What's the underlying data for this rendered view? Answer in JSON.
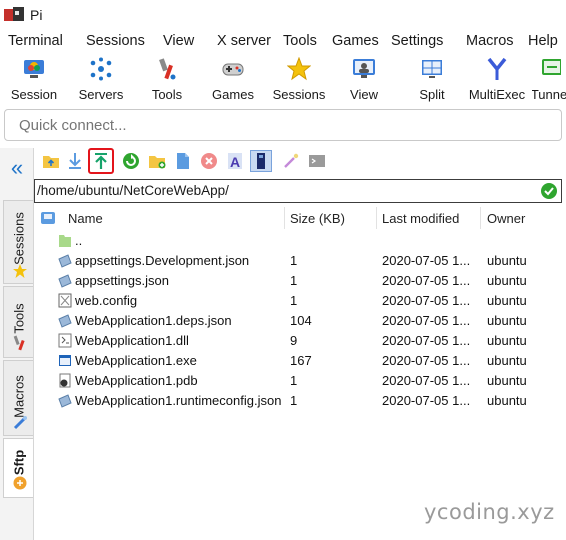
{
  "window": {
    "title": "Pi"
  },
  "menu": [
    "Terminal",
    "Sessions",
    "View",
    "X server",
    "Tools",
    "Games",
    "Settings",
    "Macros",
    "Help"
  ],
  "toolbar": [
    {
      "label": "Session",
      "icon": "session-icon"
    },
    {
      "label": "Servers",
      "icon": "servers-icon"
    },
    {
      "label": "Tools",
      "icon": "tools-icon"
    },
    {
      "label": "Games",
      "icon": "games-icon"
    },
    {
      "label": "Sessions",
      "icon": "star-icon"
    },
    {
      "label": "View",
      "icon": "view-icon"
    },
    {
      "label": "Split",
      "icon": "split-icon"
    },
    {
      "label": "MultiExec",
      "icon": "multiexec-icon"
    },
    {
      "label": "Tunne",
      "icon": "tunneling-icon"
    }
  ],
  "quick_connect": {
    "placeholder": "Quick connect..."
  },
  "sidebar": {
    "tabs": [
      {
        "label": "Sessions",
        "icon": "star-icon"
      },
      {
        "label": "Tools",
        "icon": "tools-icon"
      },
      {
        "label": "Macros",
        "icon": "macro-icon"
      },
      {
        "label": "Sftp",
        "icon": "sftp-icon"
      }
    ]
  },
  "sftp": {
    "toolbar_icons": [
      "parent-folder-icon",
      "download-icon",
      "upload-icon",
      "refresh-icon",
      "new-folder-icon",
      "new-file-icon",
      "delete-icon",
      "rename-icon",
      "follow-terminal-icon",
      "magic-wand-icon",
      "terminal-icon"
    ],
    "path": "/home/ubuntu/NetCoreWebApp/",
    "columns": [
      "Name",
      "Size (KB)",
      "Last modified",
      "Owner"
    ],
    "rows": [
      {
        "name": "..",
        "size": "",
        "modified": "",
        "owner": "",
        "icon": "parent-folder-icon"
      },
      {
        "name": "appsettings.Development.json",
        "size": "1",
        "modified": "2020-07-05 1...",
        "owner": "ubuntu",
        "icon": "json-file-icon"
      },
      {
        "name": "appsettings.json",
        "size": "1",
        "modified": "2020-07-05 1...",
        "owner": "ubuntu",
        "icon": "json-file-icon"
      },
      {
        "name": "web.config",
        "size": "1",
        "modified": "2020-07-05 1...",
        "owner": "ubuntu",
        "icon": "config-file-icon"
      },
      {
        "name": "WebApplication1.deps.json",
        "size": "104",
        "modified": "2020-07-05 1...",
        "owner": "ubuntu",
        "icon": "json-file-icon"
      },
      {
        "name": "WebApplication1.dll",
        "size": "9",
        "modified": "2020-07-05 1...",
        "owner": "ubuntu",
        "icon": "dll-file-icon"
      },
      {
        "name": "WebApplication1.exe",
        "size": "167",
        "modified": "2020-07-05 1...",
        "owner": "ubuntu",
        "icon": "exe-file-icon"
      },
      {
        "name": "WebApplication1.pdb",
        "size": "1",
        "modified": "2020-07-05 1...",
        "owner": "ubuntu",
        "icon": "pdb-file-icon"
      },
      {
        "name": "WebApplication1.runtimeconfig.json",
        "size": "1",
        "modified": "2020-07-05 1...",
        "owner": "ubuntu",
        "icon": "json-file-icon"
      }
    ]
  },
  "watermark": "ycoding.xyz",
  "colors": {
    "accent": "#1e73c8",
    "highlight": "#e3141b",
    "ok": "#2fa52f"
  }
}
